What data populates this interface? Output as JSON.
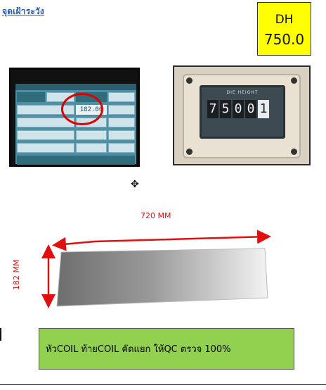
{
  "heading": "จุดเฝ้าระวัง",
  "dh": {
    "label": "DH",
    "value": "750.0"
  },
  "counter_photo": {
    "title": "DIE HEIGHT",
    "digits": [
      "7",
      "5",
      "0",
      "0",
      "1"
    ]
  },
  "panel_photo": {
    "display_value": "182.00"
  },
  "dimensions": {
    "width": "720 MM",
    "height": "182 MM"
  },
  "note": "หัวCOIL ท้ายCOIL คัดแยก ให้QC ตรวจ  100%"
}
